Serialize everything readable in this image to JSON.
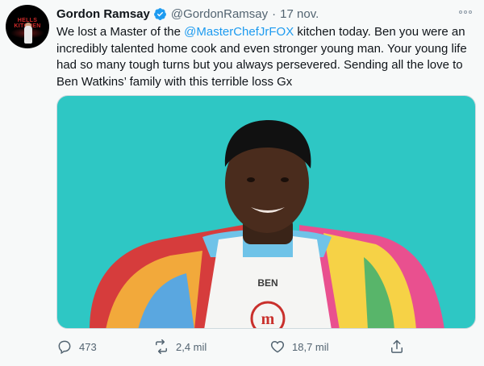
{
  "tweet": {
    "display_name": "Gordon Ramsay",
    "handle": "@GordonRamsay",
    "separator": "·",
    "date": "17 nov.",
    "text_before": "We lost a Master of the ",
    "mention": "@MasterChefJrFOX",
    "text_after": " kitchen today. Ben you were an incredibly talented home cook and even stronger young man. Your young life had so many tough turns but you always persevered. Sending all the love to Ben Watkins’ family with this terrible loss Gx",
    "avatar_text": "HELLS KITCHEN"
  },
  "media": {
    "apron_name": "BEN",
    "logo_letter": "m",
    "background_color": "#2ec7c4"
  },
  "actions": {
    "replies": "473",
    "retweets": "2,4 mil",
    "likes": "18,7 mil"
  },
  "icons": {
    "verified": "verified-badge-icon",
    "more": "more-icon",
    "reply": "reply-icon",
    "retweet": "retweet-icon",
    "like": "heart-icon",
    "share": "share-icon"
  },
  "colors": {
    "accent": "#1d9bf0",
    "muted": "#536471",
    "text": "#0f1419"
  }
}
